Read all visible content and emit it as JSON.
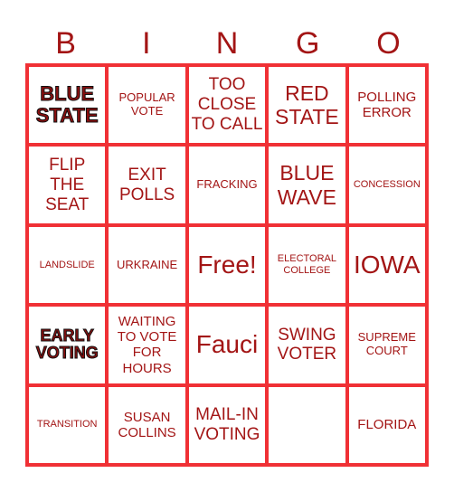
{
  "header": {
    "letters": [
      "B",
      "I",
      "N",
      "G",
      "O"
    ]
  },
  "colors": {
    "border": "#f03035",
    "text": "#a31515"
  },
  "cells": [
    {
      "text": "BLUE STATE",
      "style": "stroked"
    },
    {
      "text": "POPULAR VOTE",
      "style": "s-sm"
    },
    {
      "text": "TOO CLOSE TO CALL",
      "style": "s-lg"
    },
    {
      "text": "RED STATE",
      "style": "s-xl"
    },
    {
      "text": "POLLING ERROR",
      "style": "s-md"
    },
    {
      "text": "FLIP THE SEAT",
      "style": "s-lg"
    },
    {
      "text": "EXIT POLLS",
      "style": "s-lg"
    },
    {
      "text": "FRACKING",
      "style": "s-sm"
    },
    {
      "text": "BLUE WAVE",
      "style": "s-xl"
    },
    {
      "text": "CONCESSION",
      "style": "s-xs"
    },
    {
      "text": "LANDSLIDE",
      "style": "s-xs"
    },
    {
      "text": "URKRAINE",
      "style": "s-sm"
    },
    {
      "text": "Free!",
      "style": "s-xxl"
    },
    {
      "text": "ELECTORAL COLLEGE",
      "style": "s-xs"
    },
    {
      "text": "IOWA",
      "style": "s-xxl"
    },
    {
      "text": "EARLY VOTING",
      "style": "stroked small"
    },
    {
      "text": "WAITING TO VOTE FOR HOURS",
      "style": "s-md"
    },
    {
      "text": "Fauci",
      "style": "s-xxl"
    },
    {
      "text": "SWING VOTER",
      "style": "s-lg"
    },
    {
      "text": "SUPREME COURT",
      "style": "s-sm"
    },
    {
      "text": "TRANSITION",
      "style": "s-xs"
    },
    {
      "text": "SUSAN COLLINS",
      "style": "s-md"
    },
    {
      "text": "MAIL-IN VOTING",
      "style": "s-lg"
    },
    {
      "text": "",
      "style": "s-md"
    },
    {
      "text": "FLORIDA",
      "style": "s-md"
    }
  ]
}
